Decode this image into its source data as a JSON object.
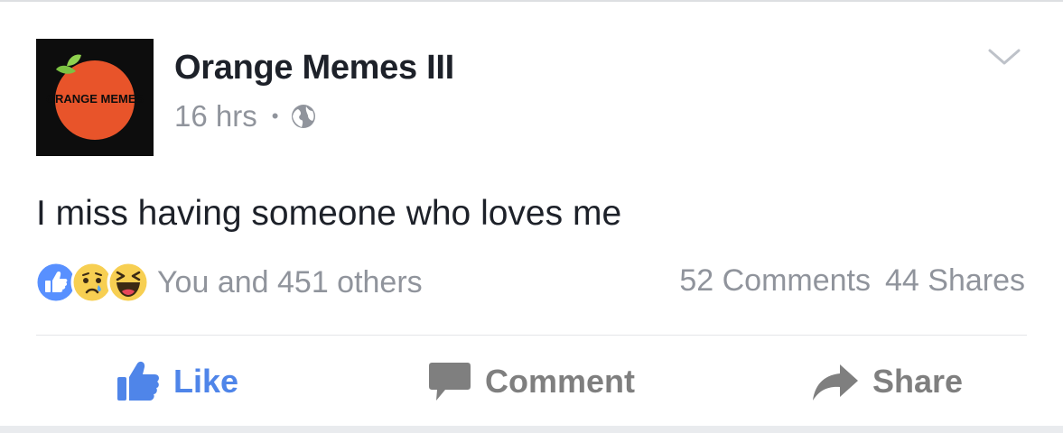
{
  "post": {
    "page_name": "Orange Memes III",
    "avatar_text": "ORANGE MEMES",
    "time": "16 hrs",
    "separator": "•",
    "audience_icon": "globe-icon",
    "text": "I miss having someone who loves me",
    "menu_icon": "chevron-down-icon"
  },
  "reactions": {
    "icons": [
      "like-reaction-icon",
      "sad-reaction-icon",
      "haha-reaction-icon"
    ],
    "summary": "You and 451 others",
    "comments": "52 Comments",
    "shares": "44 Shares"
  },
  "actions": {
    "like": "Like",
    "comment": "Comment",
    "share": "Share"
  },
  "colors": {
    "like_blue": "#4f85e9",
    "text": "#1d2129",
    "muted": "#90949c",
    "avatar_orange": "#e8542a"
  }
}
